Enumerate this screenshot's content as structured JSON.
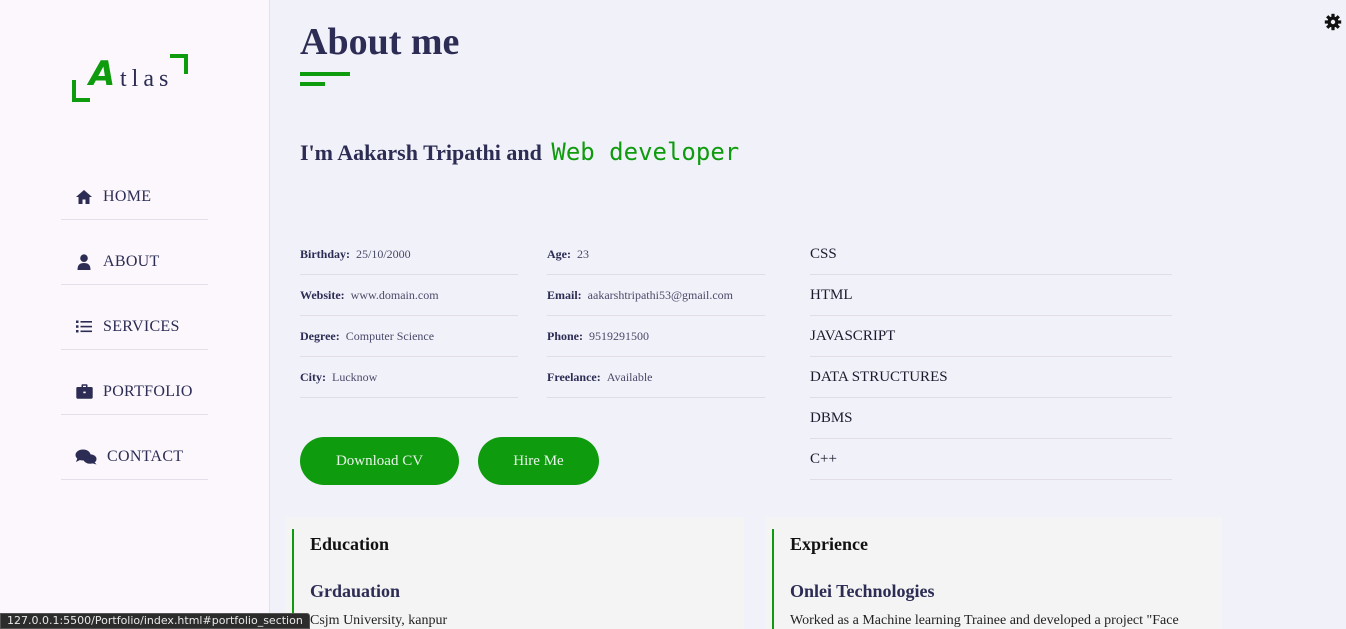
{
  "logo": {
    "first_letter": "A",
    "rest": "tlas"
  },
  "nav": [
    {
      "label": "HOME",
      "icon": "home-icon"
    },
    {
      "label": "ABOUT",
      "icon": "user-icon"
    },
    {
      "label": "SERVICES",
      "icon": "list-icon"
    },
    {
      "label": "PORTFOLIO",
      "icon": "briefcase-icon"
    },
    {
      "label": "CONTACT",
      "icon": "comments-icon"
    }
  ],
  "page": {
    "title": "About me",
    "intro": "I'm Aakarsh Tripathi and",
    "role": "Web developer"
  },
  "info": {
    "col1": [
      {
        "key": "Birthday:",
        "value": "25/10/2000"
      },
      {
        "key": "Website:",
        "value": "www.domain.com"
      },
      {
        "key": "Degree:",
        "value": "Computer Science"
      },
      {
        "key": "City:",
        "value": "Lucknow"
      }
    ],
    "col2": [
      {
        "key": "Age:",
        "value": "23"
      },
      {
        "key": "Email:",
        "value": "aakarshtripathi53@gmail.com"
      },
      {
        "key": "Phone:",
        "value": "9519291500"
      },
      {
        "key": "Freelance:",
        "value": "Available"
      }
    ]
  },
  "skills": [
    "CSS",
    "HTML",
    "JAVASCRIPT",
    "DATA STRUCTURES",
    "DBMS",
    "C++"
  ],
  "buttons": {
    "download_cv": "Download CV",
    "hire_me": "Hire Me"
  },
  "education": {
    "heading": "Education",
    "item_title": "Grdauation",
    "item_text": "Csjm University, kanpur"
  },
  "experience": {
    "heading": "Exprience",
    "item_title": "Onlei Technologies",
    "item_text": "Worked as a Machine learning Trainee and developed a project \"Face"
  },
  "status_bar": "127.0.0.1:5500/Portfolio/index.html#portfolio_section",
  "colors": {
    "accent": "#0e9b0e",
    "text": "#2c2c54",
    "sidebar_bg": "#fbf7fc",
    "main_bg": "#f1f1f9"
  }
}
